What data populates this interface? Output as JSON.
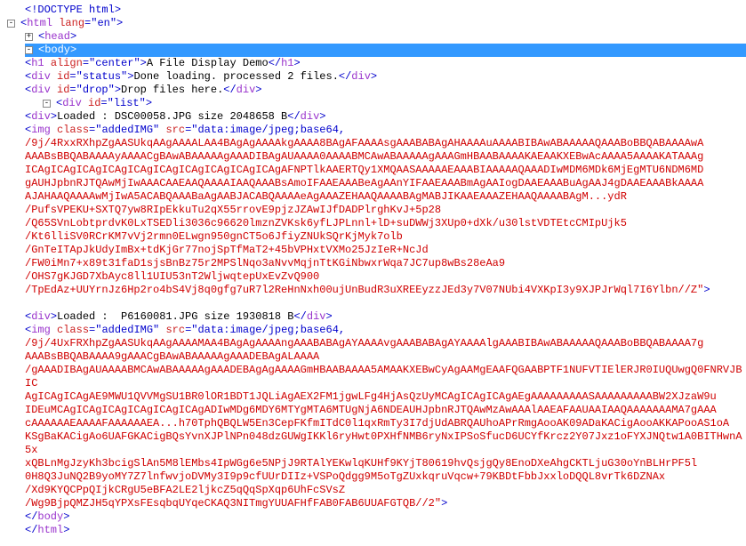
{
  "doctype": "<!DOCTYPE html>",
  "htmlOpen": {
    "tag": "html",
    "attrs": [
      [
        "lang",
        "en"
      ]
    ]
  },
  "headRow": {
    "tag": "head",
    "toggle": "+"
  },
  "bodyRow": {
    "tag": "body",
    "toggle": "-"
  },
  "h1": {
    "tag": "h1",
    "attrs": [
      [
        "align",
        "center"
      ]
    ],
    "text": "A File Display Demo"
  },
  "statusDiv": {
    "tag": "div",
    "attrs": [
      [
        "id",
        "status"
      ]
    ],
    "text": "Done loading. processed 2 files."
  },
  "dropDiv": {
    "tag": "div",
    "attrs": [
      [
        "id",
        "drop"
      ]
    ],
    "text": "Drop files here."
  },
  "listDiv": {
    "tag": "div",
    "attrs": [
      [
        "id",
        "list"
      ]
    ],
    "toggle": "-"
  },
  "load1": {
    "tag": "div",
    "text": "Loaded : DSC00058.JPG size 2048658 B"
  },
  "img1": {
    "tag": "img",
    "attrs": [
      [
        "class",
        "addedIMG"
      ]
    ],
    "srcPrefix": "data:image/jpeg;base64,",
    "srcLines": [
      "/9j/4RxxRXhpZgAASUkqAAgAAAALAA4BAgAgAAAAkgAAAA8BAgAFAAAAsgAAABABAgAHAAAAuAAAABIBAwABAAAAAQAAABoBBQABAAAAwA",
      "AAABsBBQABAAAAyAAAACgBAwABAAAAAgAAADIBAgAUAAAA0AAAABMCAwABAAAAAgAAAGmHBAABAAAAKAEAAKXEBwAcAAAA5AAAAKATAAAg",
      "ICAgICAgICAgICAgICAgICAgICAgICAgICAgICAgAFNPTlkAAERTQy1XMQAASAAAAAEAAABIAAAAAQAAADIwMDM6MDk6MjEgMTU6NDM6MD",
      "gAUHJpbnRJTQAwMjIwAAACAAEAAQAAAAIAAQAAABsAmoIFAAEAAABeAgAAnYIFAAEAAABmAgAAIogDAAEAAABuAgAAJ4gDAAEAAABkAAAA",
      "AJAHAAQAAAAwMjIwA5ACABQAAABaAgAABJACABQAAAAeAgAAAZEHAAQAAAABAgMABJIKAAEAAAZEHAAQAAAABAgM...ydR",
      "/PufsVPEKU+SXTQ7yw8RIpEkkuTu2qX55rrovE9pjzJZAwIJfDADPlrghKvJ+5p28",
      "/Q65SVnLobtprdvK0LxTSEDli3036c96620lmznZVKsk6yfLJPLnnl+lD+suDWWj3XUp0+dXk/u30lstVDTEtcCMIpUjk5",
      "/Kt6lliSV0RCrKM7vVj2rmn0ELwgn950gnCT5o6JfiyZNUkSQrKjMyk7olb",
      "/GnTeITApJkUdyImBx+tdKjGr77nojSpTfMaT2+45bVPHxtVXMo25JzIeR+NcJd",
      "/FW0iMn7+x89t31faD1sjsBnBz75r2MPSlNqo3aNvvMqjnTtKGiNbwxrWqa7JC7up8wBs28eAa9",
      "/OHS7gKJGD7XbAyc8ll1UIU53nT2WljwqtepUxEvZvQ900",
      "/TpEdAz+UUYrnJz6Hp2ro4bS4Vj8q0gfg7uR7l2ReHnNxh00ujUnBudR3uXREEyzzJEd3y7V07NUbi4VXKpI3y9XJPJrWql7I6Ylbn//Z\""
    ]
  },
  "load2": {
    "tag": "div",
    "text": "Loaded :  P6160081.JPG size 1930818 B"
  },
  "img2": {
    "tag": "img",
    "attrs": [
      [
        "class",
        "addedIMG"
      ]
    ],
    "srcPrefix": "data:image/jpeg;base64,",
    "srcLines": [
      "/9j/4UxFRXhpZgAASUkqAAgAAAAMAA4BAgAgAAAAngAAABABAgAYAAAAvgAAABABAgAYAAAAlgAAABIBAwABAAAAAQAAABoBBQABAAAA7g",
      "AAABsBBQABAAAA9gAAACgBAwABAAAAAgAAADEBAgALAAAA",
      "/gAAADIBAgAUAAAABMCAwABAAAAAgAAADEBAgAgAAAAGmHBAABAAAA5AMAAKXEBwCyAgAAMgEAAFQGAABPTF1NUFVTIElERJR0IUQUwgQ0FNRVJBIC",
      "AgICAgICAgAE9MWU1QVVMgSU1BR0lOR1BDT1JQLiAgAEX2FM1jgwLFg4HjAsQzUyMCAgICAgICAgAEgAAAAAAAAASAAAAAAAAABW2XJzaW9u",
      "IDEuMCAgICAgICAgICAgICAgICAgADIwMDg6MDY6MTYgMTA6MTUgNjA6NDEAUHJpbnRJTQAwMzAwAAAlAAEAFAAUAAIAAQAAAAAAAMA7gAAA",
      "cAAAAAAEAAAAFAAAAAAEA...h70TphQBQLW5En3CepFKfmITdC0l1qxRmTy3I7djUdABRQAUhoAPrRmgAooAK09ADaKACigAooAKKAPooAS1oA",
      "KSgBaKACigAo6UAFGKACigBQsYvnXJPlNPn048dzGUWgIKKl6ryHwt0PXHfNMB6ryNxIPSoSfucD6UCYfKrcz2Y07Jxz1oFYXJNQtw1A0BITHwnA5x",
      "xQBLnMgJzyKh3bcigSlAn5M8lEMbs4IpWGg6e5NPjJ9RTAlYEKwlqKUHf9KYjT80619hvQsjgQy8EnoDXeAhgCKTLjuG30oYnBLHrPF5l",
      "0H8Q3JuNQ2B9yoMY7Z7lnfwvjoDVMy3I9p9cfUUrDIIz+VSPoQdgg9M5oTgZUxkqruVqcw+79KBDtFbbJxxloDQQL8vrTk6DZNAx",
      "/Xd9KYQCPpQIjkCRgU5eBFA2LE2ljkcZ5qQqSpXqp6UhFcSVsZ",
      "/Wg9BjpQMZJH5qYPXsFEsqbqUYqeCKAQ3NITmgYUUAFHfFAB0FAB6UUAFGTQB//2\""
    ]
  },
  "bodyClose": "body",
  "htmlClose": "html"
}
